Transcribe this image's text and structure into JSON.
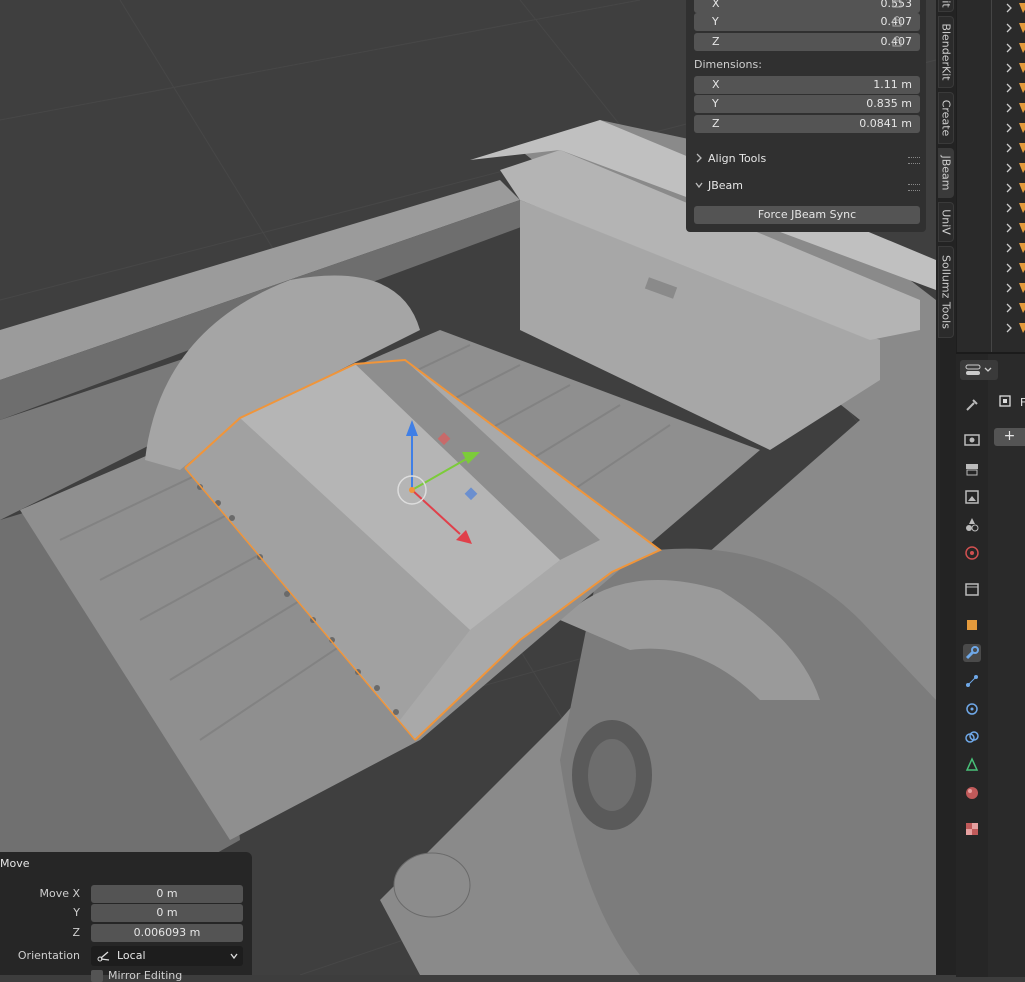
{
  "npanel": {
    "scale": [
      {
        "axis": "X",
        "value": "0.553"
      },
      {
        "axis": "Y",
        "value": "0.407"
      },
      {
        "axis": "Z",
        "value": "0.407"
      }
    ],
    "dimensions_label": "Dimensions:",
    "dimensions": [
      {
        "axis": "X",
        "value": "1.11 m"
      },
      {
        "axis": "Y",
        "value": "0.835 m"
      },
      {
        "axis": "Z",
        "value": "0.0841 m"
      }
    ],
    "align_tools_label": "Align Tools",
    "jbeam_label": "JBeam",
    "force_sync_label": "Force JBeam Sync"
  },
  "tabs": {
    "tab0": "it",
    "tab1": "BlenderKit",
    "tab2": "Create",
    "tab3": "JBeam",
    "tab4": "UniV",
    "tab5": "Sollumz Tools"
  },
  "properties": {
    "clipped_letter": "F",
    "plus": "+"
  },
  "redo_panel": {
    "title": "Move",
    "move_x_label": "Move X",
    "move_x": "0 m",
    "y_label": "Y",
    "move_y": "0 m",
    "z_label": "Z",
    "move_z": "0.006093 m",
    "orientation_label": "Orientation",
    "orientation_value": "Local",
    "proportional_label": "Mirror Editing"
  },
  "colors": {
    "selection_outline": "#f0953a",
    "gizmo_x": "#e0404a",
    "gizmo_y": "#7ccb3a",
    "gizmo_z": "#3f7fe6"
  }
}
